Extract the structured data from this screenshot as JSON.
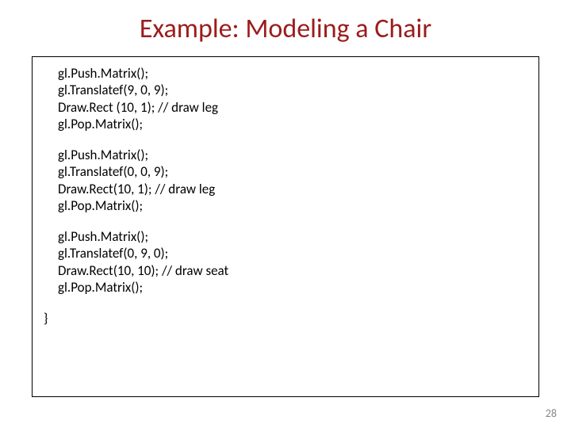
{
  "title": "Example: Modeling a Chair",
  "blocks": [
    {
      "lines": [
        "gl.Push.Matrix();",
        "gl.Translatef(9, 0, 9);",
        "Draw.Rect (10, 1); // draw leg",
        "gl.Pop.Matrix();"
      ]
    },
    {
      "lines": [
        "gl.Push.Matrix();",
        "gl.Translatef(0, 0, 9);",
        " Draw.Rect(10, 1); // draw leg",
        "gl.Pop.Matrix();"
      ]
    },
    {
      "lines": [
        "gl.Push.Matrix();",
        "gl.Translatef(0, 9, 0);",
        "Draw.Rect(10, 10); // draw seat",
        "gl.Pop.Matrix();"
      ]
    }
  ],
  "closebrace": "}",
  "pagenum": "28"
}
